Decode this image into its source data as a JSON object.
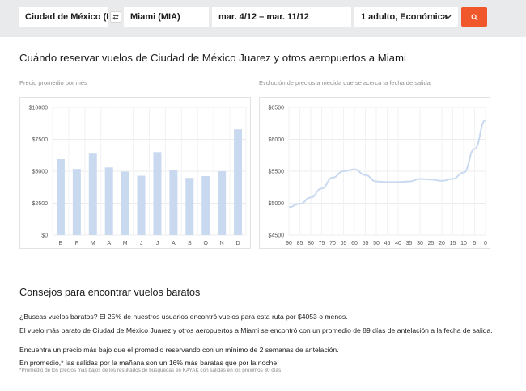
{
  "search": {
    "origin": "Ciudad de México (M",
    "destination": "Miami (MIA)",
    "dates": "mar. 4/12 – mar. 11/12",
    "passengers": "1 adulto, Económica"
  },
  "heading": "Cuándo reservar vuelos de Ciudad de México Juarez y otros aeropuertos a Miami",
  "chart_data": [
    {
      "type": "bar",
      "title": "Precio promedio por mes",
      "categories": [
        "E",
        "F",
        "M",
        "A",
        "M",
        "J",
        "J",
        "A",
        "S",
        "O",
        "N",
        "D"
      ],
      "values": [
        5950,
        5180,
        6380,
        5300,
        4970,
        4650,
        6500,
        5080,
        4480,
        4620,
        5000,
        8280
      ],
      "ylim": [
        0,
        10000
      ],
      "yticks": [
        "$0",
        "$2500",
        "$5000",
        "$7500",
        "$10000"
      ],
      "grid": true,
      "color": "#c9daf0"
    },
    {
      "type": "line",
      "title": "Evolución de precios a medida que se acerca la fecha de salida",
      "x": [
        90,
        85,
        80,
        75,
        70,
        65,
        60,
        55,
        50,
        45,
        40,
        35,
        30,
        25,
        20,
        15,
        10,
        5,
        0
      ],
      "values": [
        4940,
        4990,
        5090,
        5230,
        5400,
        5500,
        5530,
        5440,
        5340,
        5330,
        5330,
        5340,
        5380,
        5370,
        5350,
        5380,
        5480,
        5850,
        6300
      ],
      "xlim": [
        90,
        0
      ],
      "ylim": [
        4500,
        6500
      ],
      "xticks": [
        "90",
        "85",
        "80",
        "75",
        "70",
        "65",
        "60",
        "55",
        "50",
        "45",
        "40",
        "35",
        "30",
        "25",
        "20",
        "15",
        "10",
        "5",
        "0"
      ],
      "yticks": [
        "$4500",
        "$5000",
        "$5500",
        "$6000",
        "$6500"
      ],
      "grid": true,
      "color": "#c9daf0"
    }
  ],
  "tips": {
    "heading": "Consejos para encontrar vuelos baratos",
    "t1": "¿Buscas vuelos baratos? El 25% de nuestros usuarios encontró vuelos para esta ruta por $4053 o menos.",
    "t2": "El vuelo más barato de Ciudad de México Juarez y otros aeropuertos a Miami se encontró con un promedio de 89 días de antelación a la fecha de salida.",
    "t3": "Encuentra un precio más bajo que el promedio reservando con un mínimo de 2 semanas de antelación.",
    "t4": "En promedio,* las salidas por la mañana son un 16% más baratas que por la noche.",
    "footnote": "*Promedio de los precios más bajos de los resultados de búsquedas en KAYAK con salidas en los próximos 30 días"
  }
}
